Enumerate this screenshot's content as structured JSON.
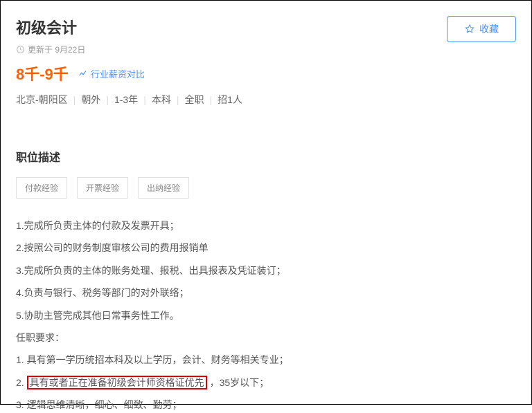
{
  "job_title": "初级会计",
  "update_text": "更新于 9月22日",
  "salary": "8千-9千",
  "compare_link": "行业薪资对比",
  "meta": {
    "location": "北京-朝阳区",
    "area": "朝外",
    "experience": "1-3年",
    "education": "本科",
    "job_type": "全职",
    "headcount": "招1人"
  },
  "favorite_label": "收藏",
  "section_title": "职位描述",
  "tags": [
    "付款经验",
    "开票经验",
    "出纳经验"
  ],
  "responsibilities": [
    "1.完成所负责主体的付款及发票开具；",
    "2.按照公司的财务制度审核公司的费用报销单",
    "3.完成所负责的主体的账务处理、报税、出具报表及凭证装订；",
    "4.负责与银行、税务等部门的对外联络；",
    "5.协助主管完成其他日常事务性工作。"
  ],
  "requirements_title": "任职要求：",
  "requirements": [
    {
      "prefix": "1. ",
      "text": "具有第一学历统招本科及以上学历，会计、财务等相关专业；"
    },
    {
      "prefix": "2. ",
      "highlight": "具有或者正在准备初级会计师资格证优先",
      "suffix": "，35岁以下；"
    },
    {
      "prefix": "3. ",
      "text": "逻辑思维清晰，细心、细致、勤劳；"
    }
  ]
}
